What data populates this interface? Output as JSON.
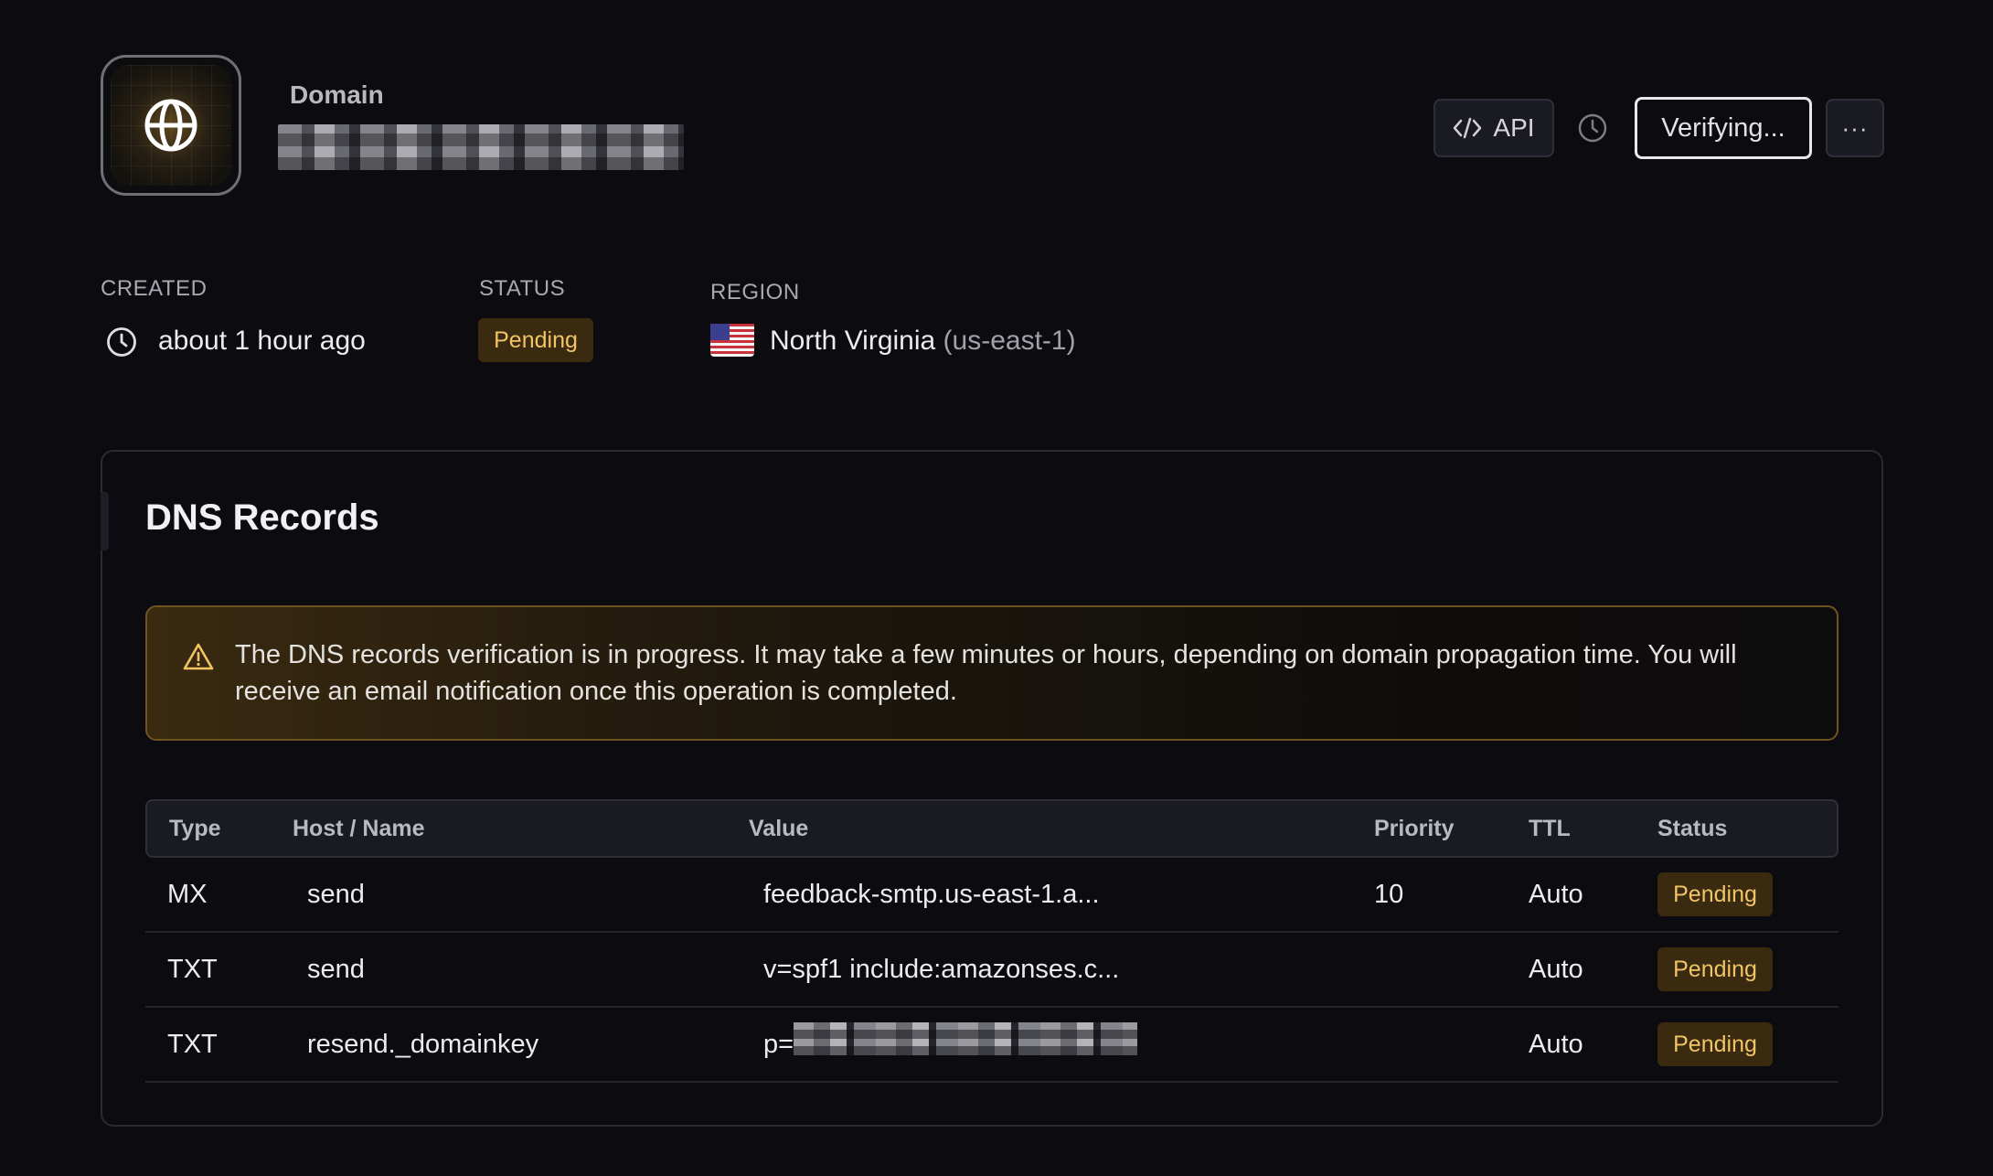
{
  "header": {
    "label": "Domain",
    "api_label": "API",
    "verify_label": "Verifying...",
    "more_label": "···"
  },
  "meta": {
    "created_label": "CREATED",
    "created_value": "about 1 hour ago",
    "status_label": "STATUS",
    "status_value": "Pending",
    "region_label": "REGION",
    "region_name": "North Virginia",
    "region_code": "(us-east-1)"
  },
  "dns": {
    "title": "DNS Records",
    "alert": "The DNS records verification is in progress. It may take a few minutes or hours, depending on domain propagation time. You will receive an email notification once this operation is completed.",
    "columns": [
      "Type",
      "Host / Name",
      "Value",
      "Priority",
      "TTL",
      "Status"
    ],
    "rows": [
      {
        "type": "MX",
        "host": "send",
        "value": "feedback-smtp.us-east-1.a...",
        "priority": "10",
        "ttl": "Auto",
        "status": "Pending"
      },
      {
        "type": "TXT",
        "host": "send",
        "value": "v=spf1 include:amazonses.c...",
        "priority": "",
        "ttl": "Auto",
        "status": "Pending"
      },
      {
        "type": "TXT",
        "host": "resend._domainkey",
        "value": "p=",
        "priority": "",
        "ttl": "Auto",
        "status": "Pending"
      }
    ]
  },
  "colors": {
    "background": "#0b0b10",
    "pending_bg": "#3a2a10",
    "pending_text": "#f1c566",
    "alert_border": "#6e5420"
  },
  "icons": [
    "globe-icon",
    "code-icon",
    "clock-icon",
    "warning-icon",
    "us-flag-icon"
  ]
}
